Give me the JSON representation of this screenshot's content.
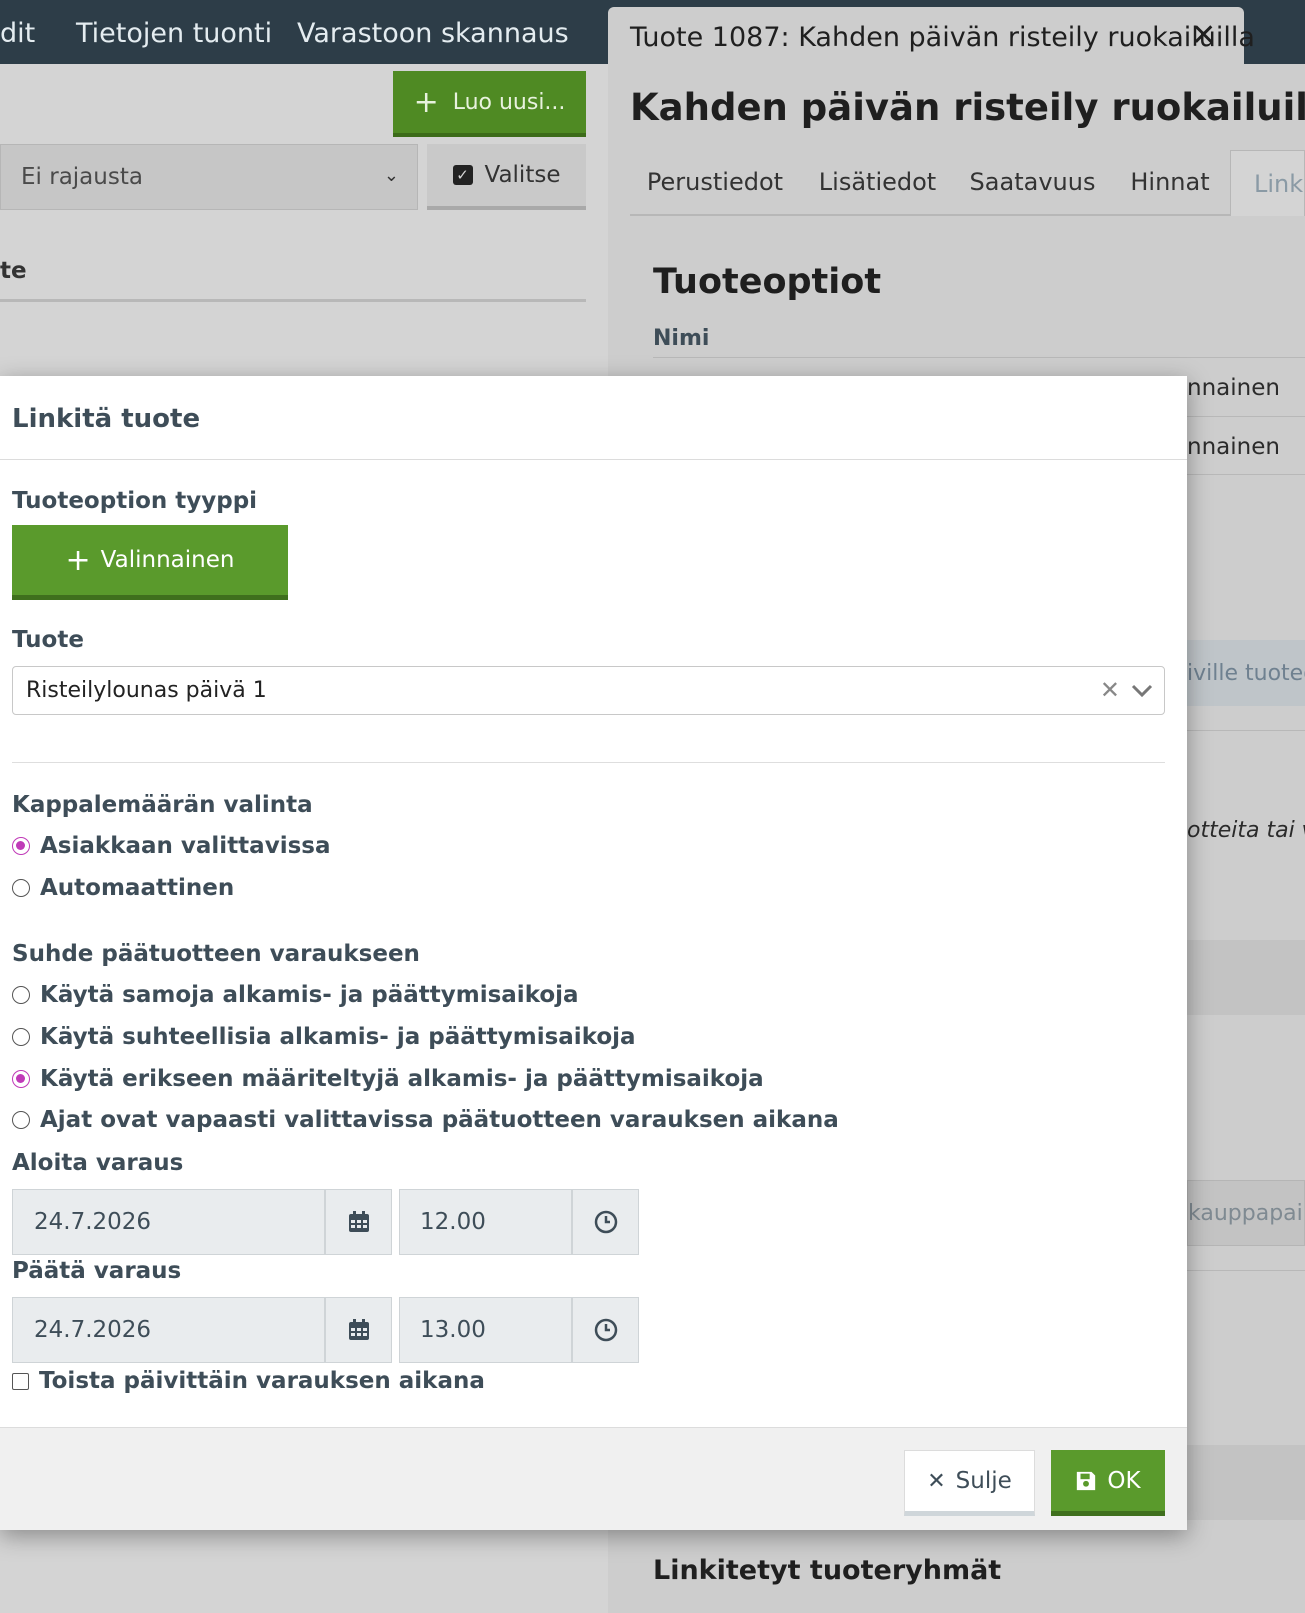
{
  "navbar": {
    "items": [
      "dit",
      "Tietojen tuonti",
      "Varastoon skannaus"
    ]
  },
  "left": {
    "create_label": "Luo uusi...",
    "filter_value": "Ei rajausta",
    "select_label": "Valitse",
    "column_header": "te"
  },
  "right": {
    "tab_label": "Tuote 1087: Kahden päivän risteily ruokailuilla",
    "product_title": "Kahden päivän risteily ruokailuilla",
    "tabs": [
      "Perustiedot",
      "Lisätiedot",
      "Saatavuus",
      "Hinnat",
      "Linkit"
    ],
    "section_title": "Tuoteoptiot",
    "name_header": "Nimi",
    "rows": [
      "nnainen",
      "nnainen"
    ],
    "button_partial": "iville tuoteo",
    "italic_partial": "otteita tai va",
    "shop_partial": "kauppapaik",
    "linked_groups": "Linkitetyt tuoteryhmät"
  },
  "modal": {
    "title": "Linkitä tuote",
    "option_type_label": "Tuoteoption tyyppi",
    "option_type_button": "Valinnainen",
    "product_label": "Tuote",
    "product_value": "Risteilylounas päivä 1",
    "quantity_label": "Kappalemäärän valinta",
    "quantity_options": [
      {
        "label": "Asiakkaan valittavissa",
        "selected": true
      },
      {
        "label": "Automaattinen",
        "selected": false
      }
    ],
    "relation_label": "Suhde päätuotteen varaukseen",
    "relation_options": [
      {
        "label": "Käytä samoja alkamis- ja päättymisaikoja",
        "selected": false
      },
      {
        "label": "Käytä suhteellisia alkamis- ja päättymisaikoja",
        "selected": false
      },
      {
        "label": "Käytä erikseen määriteltyjä alkamis- ja päättymisaikoja",
        "selected": true
      },
      {
        "label": "Ajat ovat vapaasti valittavissa päätuotteen varauksen aikana",
        "selected": false
      }
    ],
    "start_label": "Aloita varaus",
    "start_date": "24.7.2026",
    "start_time": "12.00",
    "end_label": "Päätä varaus",
    "end_date": "24.7.2026",
    "end_time": "13.00",
    "repeat_label": "Toista päivittäin varauksen aikana",
    "close_label": "Sulje",
    "ok_label": "OK"
  },
  "colors": {
    "navbar": "#2d3d48",
    "primary_green": "#5a9a2c",
    "radio_selected": "#c03ab8",
    "label_text": "#3e4d58"
  }
}
